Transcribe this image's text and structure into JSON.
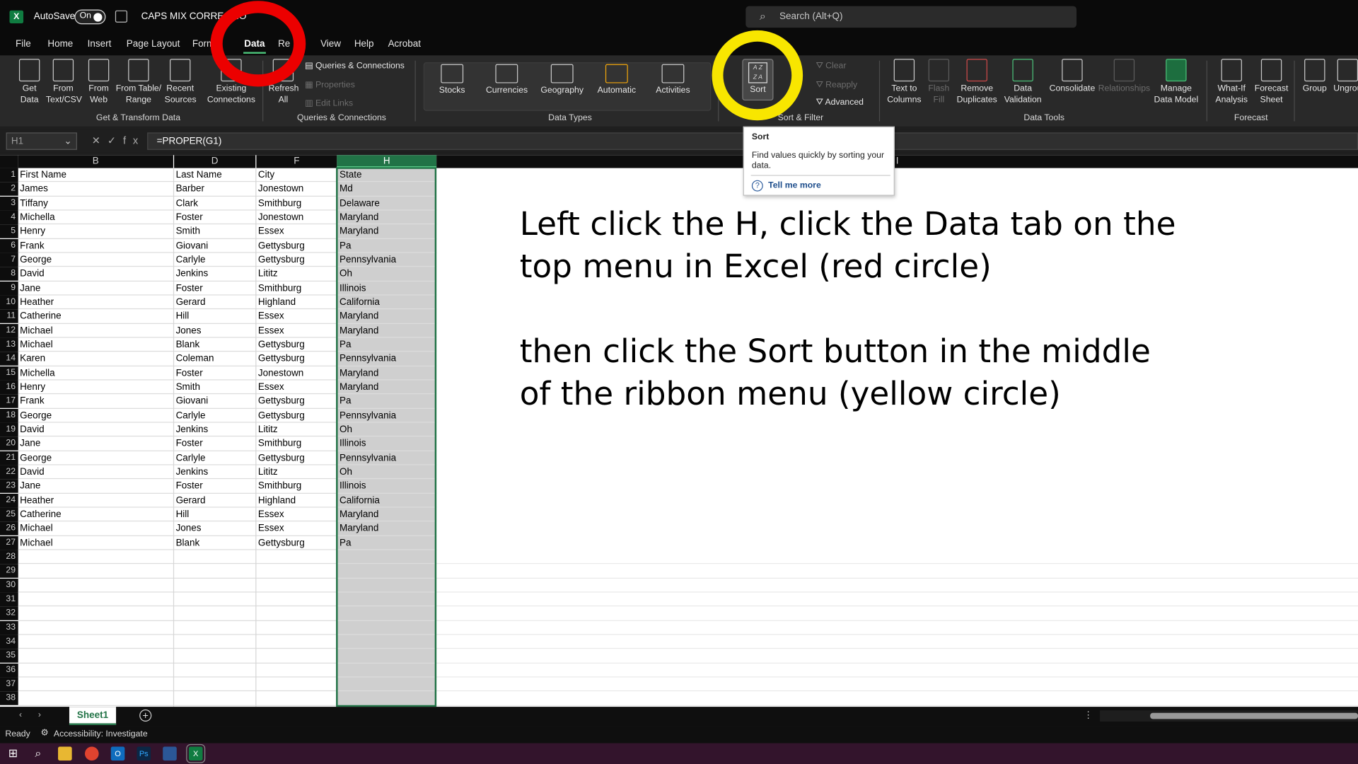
{
  "titlebar": {
    "autosave_label": "AutoSave",
    "autosave_state": "On",
    "file_title": "CAPS MIX CORRECTIO",
    "search_placeholder": "Search (Alt+Q)"
  },
  "menu": {
    "tabs": [
      "File",
      "Home",
      "Insert",
      "Page Layout",
      "Form",
      "Data",
      "Re",
      "View",
      "Help",
      "Acrobat"
    ],
    "active": "Data"
  },
  "ribbon": {
    "get_transform": {
      "get_data": "Get\nData",
      "from_text_csv": "From\nText/CSV",
      "from_web": "From\nWeb",
      "from_table_range": "From Table/\nRange",
      "recent_sources": "Recent\nSources",
      "existing_connections": "Existing\nConnections",
      "group_label": "Get & Transform Data"
    },
    "queries": {
      "refresh_all": "Refresh\nAll",
      "queries_connections": "Queries & Connections",
      "properties": "Properties",
      "edit_links": "Edit Links",
      "group_label": "Queries & Connections"
    },
    "data_types": {
      "items": [
        "Stocks",
        "Currencies",
        "Geography",
        "Automatic",
        "Activities"
      ],
      "group_label": "Data Types"
    },
    "sort_filter": {
      "sort": "Sort",
      "clear": "Clear",
      "reapply": "Reapply",
      "advanced": "Advanced",
      "group_label": "Sort & Filter"
    },
    "data_tools": {
      "text_to_columns": "Text to\nColumns",
      "flash_fill": "Flash\nFill",
      "remove_duplicates": "Remove\nDuplicates",
      "data_validation": "Data\nValidation",
      "consolidate": "Consolidate",
      "relationships": "Relationships",
      "manage_data_model": "Manage\nData Model",
      "group_label": "Data Tools"
    },
    "forecast": {
      "what_if": "What-If\nAnalysis",
      "forecast_sheet": "Forecast\nSheet",
      "group_label": "Forecast"
    },
    "outline": {
      "group": "Group",
      "ungroup": "Ungrou"
    }
  },
  "formula_bar": {
    "name_box": "H1",
    "fx": "fx",
    "formula": "=PROPER(G1)"
  },
  "grid": {
    "columns": [
      "B",
      "D",
      "F",
      "H",
      "I"
    ],
    "row_numbers": [
      "1",
      "2",
      "3",
      "4",
      "5",
      "6",
      "7",
      "8",
      "9",
      "10",
      "11",
      "12",
      "13",
      "14",
      "15",
      "16",
      "17",
      "18",
      "19",
      "20",
      "21",
      "22",
      "23",
      "24",
      "25",
      "26",
      "27",
      "28",
      "29",
      "30",
      "31",
      "32",
      "33",
      "34",
      "35",
      "36",
      "37",
      "38"
    ],
    "rows": [
      [
        "First Name",
        "Last Name",
        "City",
        "State"
      ],
      [
        "James",
        "Barber",
        "Jonestown",
        "Md"
      ],
      [
        "Tiffany",
        "Clark",
        "Smithburg",
        "Delaware"
      ],
      [
        "Michella",
        "Foster",
        "Jonestown",
        "Maryland"
      ],
      [
        "Henry",
        "Smith",
        "Essex",
        "Maryland"
      ],
      [
        "Frank",
        "Giovani",
        "Gettysburg",
        "Pa"
      ],
      [
        "George",
        "Carlyle",
        "Gettysburg",
        "Pennsylvania"
      ],
      [
        "David",
        "Jenkins",
        "Lititz",
        "Oh"
      ],
      [
        "Jane",
        "Foster",
        "Smithburg",
        "Illinois"
      ],
      [
        "Heather",
        "Gerard",
        "Highland",
        "California"
      ],
      [
        "Catherine",
        "Hill",
        "Essex",
        "Maryland"
      ],
      [
        "Michael",
        "Jones",
        "Essex",
        "Maryland"
      ],
      [
        "Michael",
        "Blank",
        "Gettysburg",
        "Pa"
      ],
      [
        "Karen",
        "Coleman",
        "Gettysburg",
        "Pennsylvania"
      ],
      [
        "Michella",
        "Foster",
        "Jonestown",
        "Maryland"
      ],
      [
        "Henry",
        "Smith",
        "Essex",
        "Maryland"
      ],
      [
        "Frank",
        "Giovani",
        "Gettysburg",
        "Pa"
      ],
      [
        "George",
        "Carlyle",
        "Gettysburg",
        "Pennsylvania"
      ],
      [
        "David",
        "Jenkins",
        "Lititz",
        "Oh"
      ],
      [
        "Jane",
        "Foster",
        "Smithburg",
        "Illinois"
      ],
      [
        "George",
        "Carlyle",
        "Gettysburg",
        "Pennsylvania"
      ],
      [
        "David",
        "Jenkins",
        "Lititz",
        "Oh"
      ],
      [
        "Jane",
        "Foster",
        "Smithburg",
        "Illinois"
      ],
      [
        "Heather",
        "Gerard",
        "Highland",
        "California"
      ],
      [
        "Catherine",
        "Hill",
        "Essex",
        "Maryland"
      ],
      [
        "Michael",
        "Jones",
        "Essex",
        "Maryland"
      ],
      [
        "Michael",
        "Blank",
        "Gettysburg",
        "Pa"
      ]
    ]
  },
  "instructions": {
    "line1": "Left click the H, click the Data tab on the",
    "line2": "top menu in Excel (red circle)",
    "line3": "then click the Sort button in the middle",
    "line4": "of the ribbon menu (yellow circle)"
  },
  "tooltip": {
    "title": "Sort",
    "description": "Find values quickly by sorting your data.",
    "link": "Tell me more"
  },
  "sheet_tabs": {
    "active": "Sheet1"
  },
  "status": {
    "ready": "Ready",
    "accessibility": "Accessibility: Investigate"
  },
  "colors": {
    "excel_green": "#217346",
    "red_circle": "#ec0000",
    "yellow_circle": "#f8e600",
    "taskbar": "#33142c"
  }
}
